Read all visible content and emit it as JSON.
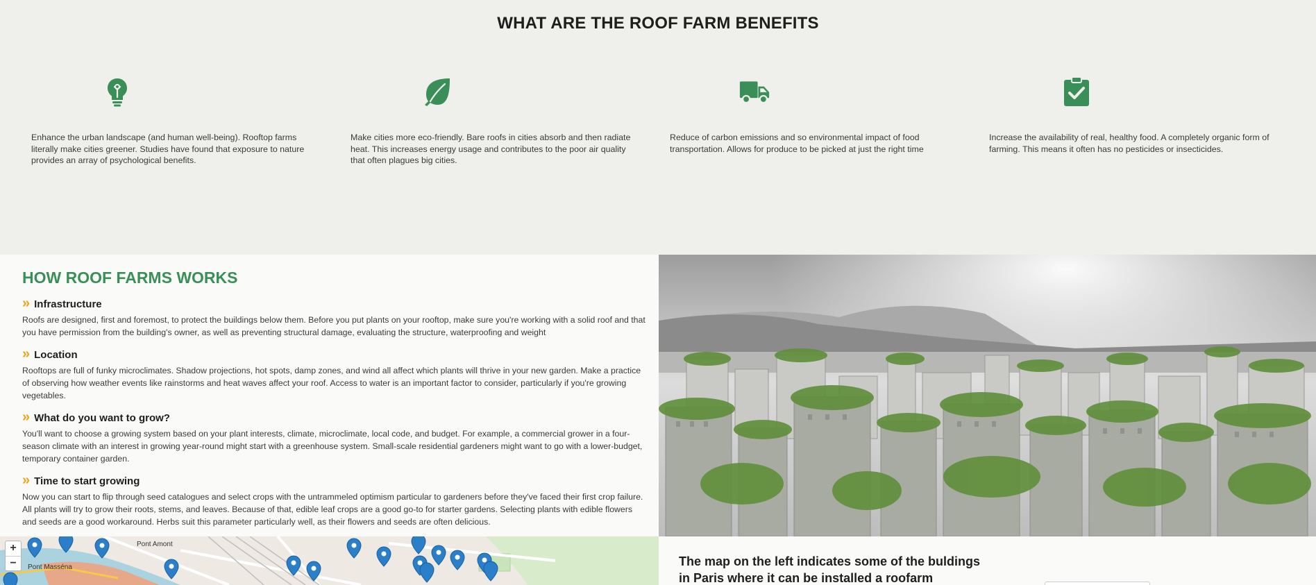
{
  "benefits": {
    "title": "WHAT ARE THE ROOF FARM BENEFITS",
    "items": [
      {
        "icon": "lightbulb-icon",
        "text": "Enhance the urban landscape (and human well-being). Rooftop farms literally make cities greener. Studies have found that exposure to nature provides an array of psychological benefits."
      },
      {
        "icon": "leaf-icon",
        "text": "Make cities more eco-friendly. Bare roofs in cities absorb and then radiate heat. This increases energy usage and contributes to the poor air quality that often plagues big cities."
      },
      {
        "icon": "truck-icon",
        "text": "Reduce of carbon emissions and so environmental impact of food transportation. Allows for produce to be picked at just the right time"
      },
      {
        "icon": "clipboard-check-icon",
        "text": "Increase the availability of real, healthy food. A completely organic form of farming. This means it often has no pesticides or insecticides."
      }
    ]
  },
  "how": {
    "title": "HOW ROOF FARMS WORKS",
    "bullet": "»",
    "items": [
      {
        "heading": "Infrastructure",
        "body": "Roofs are designed, first and foremost, to protect the buildings below them. Before you put plants on your rooftop, make sure you're working with a solid roof and that you have permission from the building's owner, as well as preventing structural damage, evaluating the structure, waterproofing and weight"
      },
      {
        "heading": "Location",
        "body": "Rooftops are full of funky microclimates. Shadow projections, hot spots, damp zones, and wind all affect which plants will thrive in your new garden. Make a practice of observing how weather events like rainstorms and heat waves affect your roof. Access to water is an important factor to consider, particularly if you're growing vegetables."
      },
      {
        "heading": "What do you want to grow?",
        "body": "You'll want to choose a growing system based on your plant interests, climate, microclimate, local code, and budget. For example, a commercial grower in a four-season climate with an interest in growing year-round might start with a greenhouse system. Small-scale residential gardeners might want to go with a lower-budget, temporary container garden."
      },
      {
        "heading": "Time to start growing",
        "body": "Now you can start to flip through seed catalogues and select crops with the untrammeled optimism particular to gardeners before they've faced their first crop failure. All plants will try to grow their roots, stems, and leaves. Because of that, edible leaf crops are a good go-to for starter gardens. Selecting plants with edible flowers and seeds are a good workaround. Herbs suit this parameter particularly well, as their flowers and seeds are often delicious."
      }
    ]
  },
  "map": {
    "zoom_in": "+",
    "zoom_out": "−",
    "labels": [
      "Pont Amont",
      "Pont Masséna"
    ],
    "caption": "The map on the left indicates some of the buldings in Paris where it can be installed a roofarm"
  },
  "colors": {
    "brand_green": "#3a8f58",
    "accent_orange": "#f0a21a",
    "marker_blue": "#2a7fc8"
  }
}
